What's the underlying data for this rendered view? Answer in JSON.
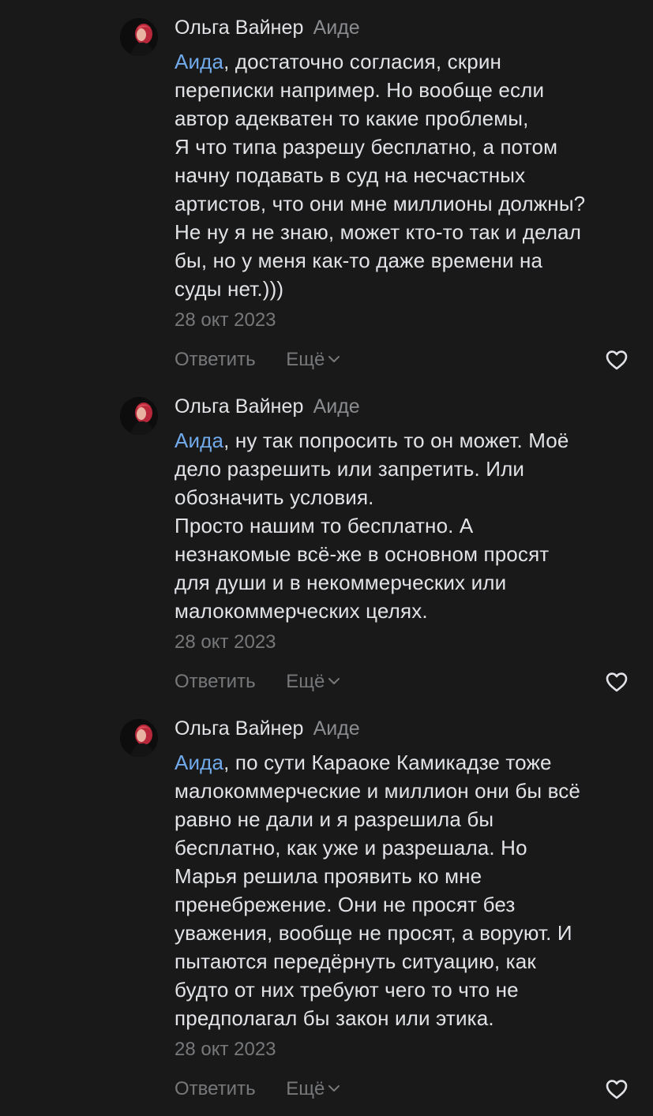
{
  "colors": {
    "background": "#19191a",
    "text": "#e1e3e6",
    "secondary": "#76787a",
    "mention": "#71aaeb"
  },
  "comments": [
    {
      "author": "Ольга Вайнер",
      "reply_to": "Аиде",
      "mention": "Аида",
      "text": ", достаточно согласия, скрин\nпереписки например. Но вообще если\nавтор адекватен то какие проблемы,\nЯ что типа разрешу бесплатно, а потом\nначну подавать в суд на несчастных\nартистов, что они мне миллионы должны?\nНе ну я не знаю, может кто-то так и делал\nбы, но у меня как-то даже времени на\nсуды нет.)))",
      "date": "28 окт 2023",
      "reply_label": "Ответить",
      "more_label": "Ещё",
      "avatar_icon": "avatar-photo",
      "like_icon": "heart-outline-icon"
    },
    {
      "author": "Ольга Вайнер",
      "reply_to": "Аиде",
      "mention": "Аида",
      "text": ", ну так попросить то он может. Моё\nдело разрешить или запретить. Или\nобозначить условия.\nПросто нашим то бесплатно. А\nнезнакомые всё-же в основном просят\nдля души и в некоммерческих или\nмалокоммерческих целях.",
      "date": "28 окт 2023",
      "reply_label": "Ответить",
      "more_label": "Ещё",
      "avatar_icon": "avatar-photo",
      "like_icon": "heart-outline-icon"
    },
    {
      "author": "Ольга Вайнер",
      "reply_to": "Аиде",
      "mention": "Аида",
      "text": ", по сути Караоке Камикадзе тоже\nмалокоммерческие и миллион они бы всё\nравно не дали и я разрешила бы\nбесплатно, как уже и разрешала. Но\nМарья решила проявить ко мне\nпренебрежение. Они не просят без\nуважения, вообще не просят, а воруют. И\nпытаются передёрнуть ситуацию, как\nбудто от них требуют чего то что не\nпредполагал бы закон или этика.",
      "date": "28 окт 2023",
      "reply_label": "Ответить",
      "more_label": "Ещё",
      "avatar_icon": "avatar-photo",
      "like_icon": "heart-outline-icon"
    }
  ]
}
